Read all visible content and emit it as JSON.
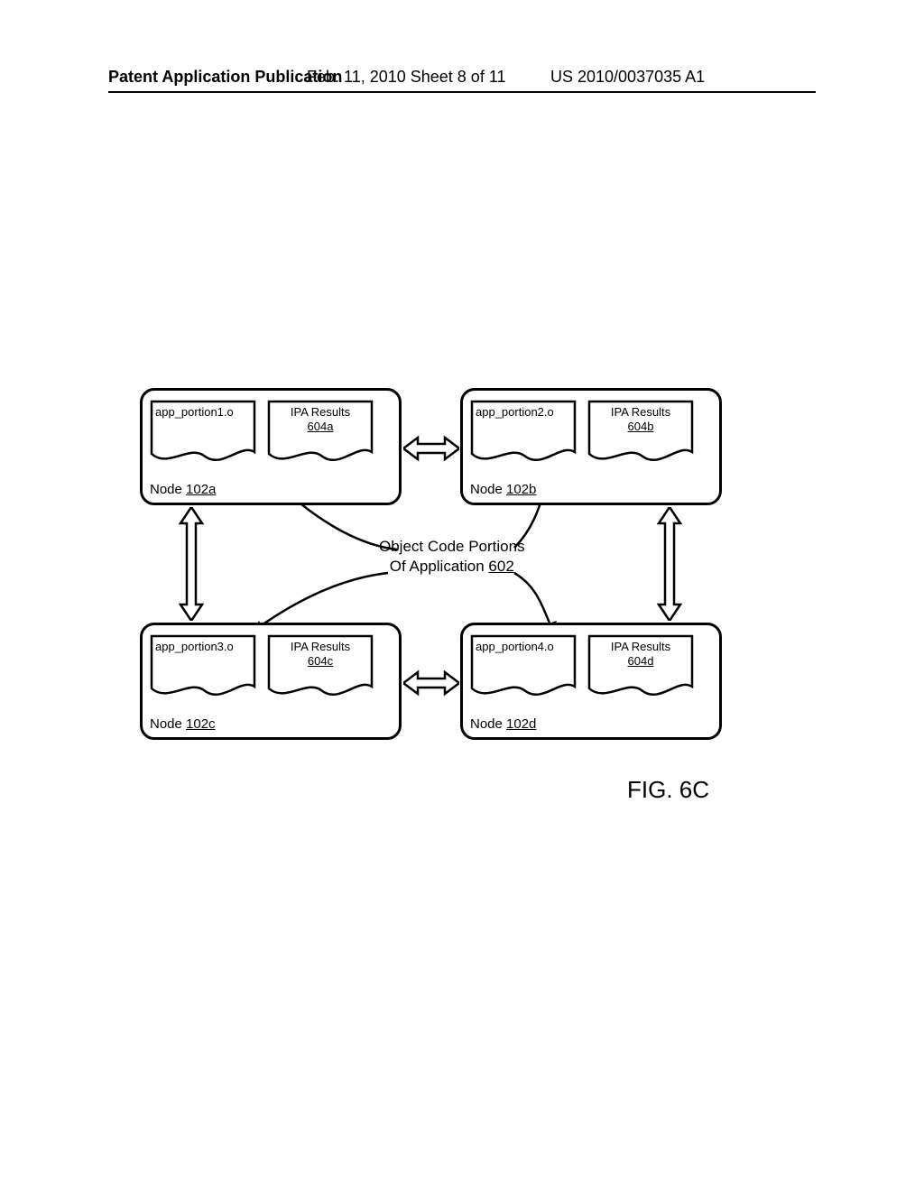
{
  "header": {
    "left": "Patent Application Publication",
    "mid": "Feb. 11, 2010  Sheet 8 of 11",
    "right": "US 2010/0037035 A1"
  },
  "center_label": {
    "line1": "Object Code Portions",
    "line2_prefix": "Of Application ",
    "line2_ref": "602"
  },
  "nodes": {
    "a": {
      "label_prefix": "Node ",
      "label_ref": "102a",
      "doc_left": "app_portion1.o",
      "doc_right_top": "IPA Results",
      "doc_right_ref": "604a"
    },
    "b": {
      "label_prefix": "Node ",
      "label_ref": "102b",
      "doc_left": "app_portion2.o",
      "doc_right_top": "IPA Results",
      "doc_right_ref": "604b"
    },
    "c": {
      "label_prefix": "Node ",
      "label_ref": "102c",
      "doc_left": "app_portion3.o",
      "doc_right_top": "IPA Results",
      "doc_right_ref": "604c"
    },
    "d": {
      "label_prefix": "Node ",
      "label_ref": "102d",
      "doc_left": "app_portion4.o",
      "doc_right_top": "IPA Results",
      "doc_right_ref": "604d"
    }
  },
  "figure_label": "FIG. 6C"
}
